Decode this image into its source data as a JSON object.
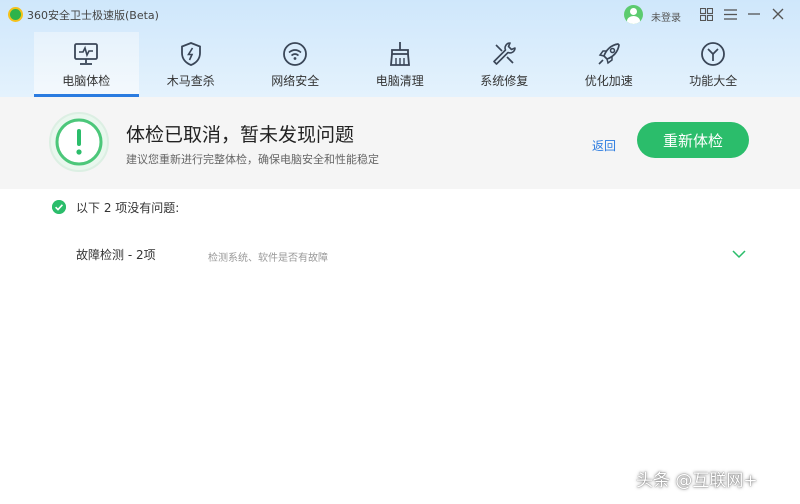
{
  "window": {
    "title": "360安全卫士极速版(Beta)",
    "login_label": "未登录"
  },
  "nav": {
    "items": [
      {
        "label": "电脑体检",
        "icon": "monitor-icon",
        "active": true
      },
      {
        "label": "木马查杀",
        "icon": "shield-icon"
      },
      {
        "label": "网络安全",
        "icon": "wifi-icon"
      },
      {
        "label": "电脑清理",
        "icon": "broom-icon"
      },
      {
        "label": "系统修复",
        "icon": "wrench-icon"
      },
      {
        "label": "优化加速",
        "icon": "rocket-icon"
      },
      {
        "label": "功能大全",
        "icon": "toolbox-icon"
      }
    ]
  },
  "status": {
    "title": "体检已取消，暂未发现问题",
    "subtitle": "建议您重新进行完整体检，确保电脑安全和性能稳定",
    "back_label": "返回",
    "recheck_label": "重新体检"
  },
  "results": {
    "summary": "以下 2 项没有问题:",
    "items": [
      {
        "title": "故障检测 - 2项",
        "description": "检测系统、软件是否有故障"
      }
    ]
  },
  "watermark": "头条 @互联网+",
  "colors": {
    "accent_blue": "#2a7be0",
    "accent_green": "#2bbd6b",
    "header_bg": "#cfe7fb"
  }
}
